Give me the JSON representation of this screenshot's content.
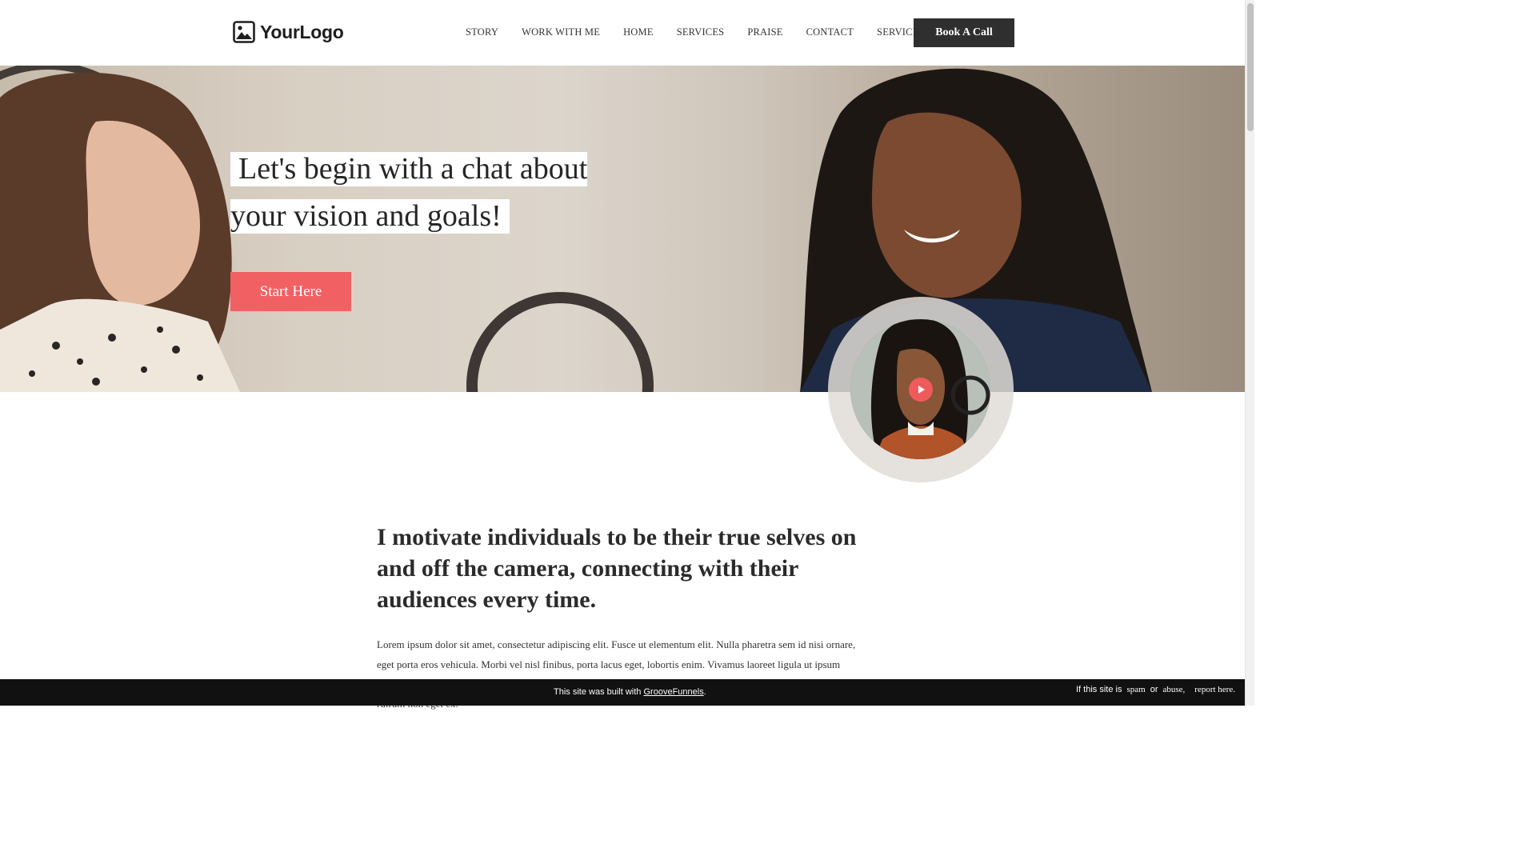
{
  "header": {
    "logo_text": "YourLogo",
    "nav": [
      "STORY",
      "WORK WITH ME",
      "HOME",
      "SERVICES",
      "PRAISE",
      "CONTACT",
      "SERVICES"
    ],
    "cta_label": "Book A Call"
  },
  "hero": {
    "title_line1": "Let's begin with a chat about",
    "title_line2": "your vision and goals!",
    "button_label": "Start Here"
  },
  "content": {
    "headline": "I motivate individuals to be their true selves on and off the camera, connecting with their audiences every time.",
    "body": "Lorem ipsum dolor sit amet, consectetur adipiscing elit. Fusce ut elementum elit. Nulla pharetra sem id nisi ornare, eget porta eros vehicula. Morbi vel nisl finibus, porta lacus eget, lobortis enim. Vivamus laoreet ligula ut ipsum sagittis lobortis. Lorem ipsum dolor sit amet, consectetur adipiscing elit. Etiam vitae enim vitae augue pretium rutrum non eget ex."
  },
  "footer": {
    "built_prefix": "This site was built with",
    "built_link": "GrooveFunnels",
    "built_suffix": ".",
    "report_prefix": "If this site is",
    "report_spam": "spam",
    "report_or": "or",
    "report_abuse": "abuse,",
    "report_link": "report here."
  },
  "colors": {
    "accent": "#f16163",
    "dark_button": "#2f2f2f",
    "footer_bg": "#111111"
  }
}
